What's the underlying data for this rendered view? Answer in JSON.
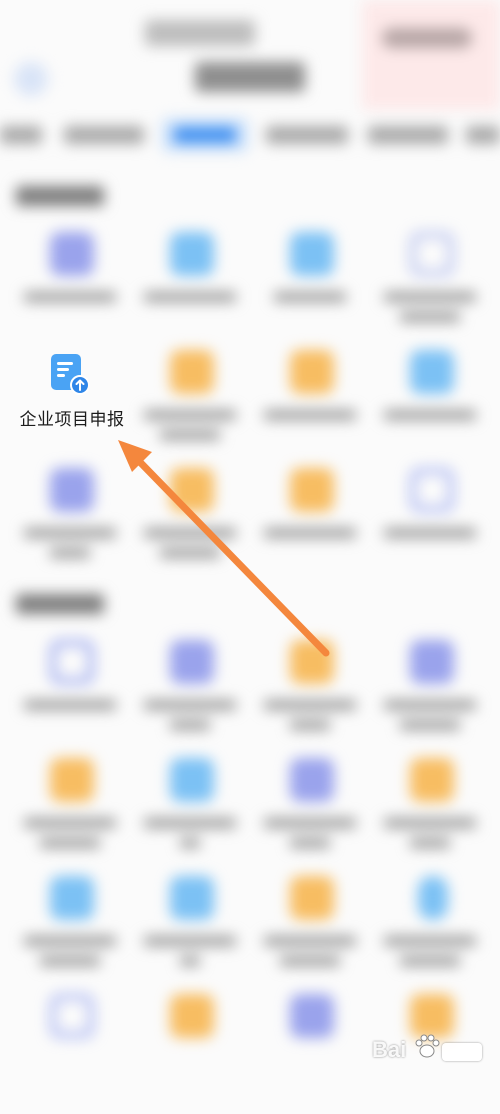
{
  "focus_item": {
    "label": "企业项目申报",
    "icon": "document-upload-icon"
  },
  "watermark": {
    "text": "Bai"
  },
  "colors": {
    "accent_blue": "#3f8ff0",
    "icon_blue": "#4aa3f4",
    "arrow_orange": "#f4873d"
  }
}
